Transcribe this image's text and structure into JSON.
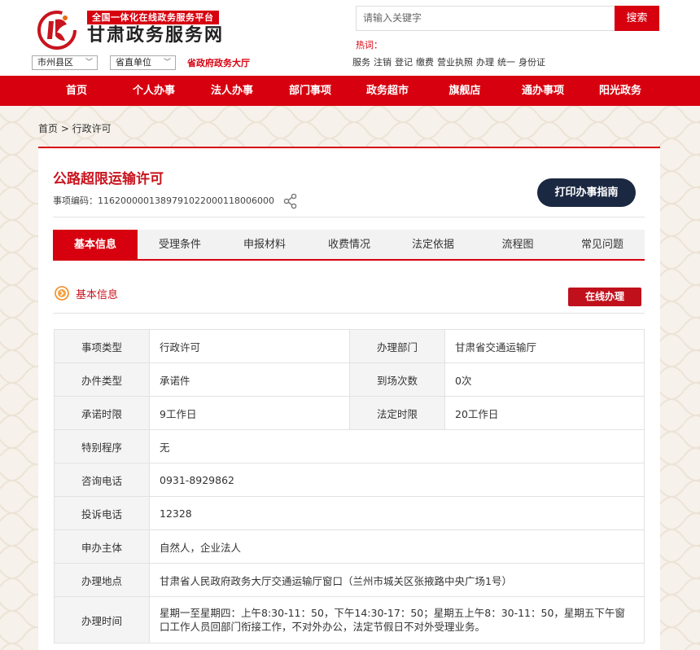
{
  "header": {
    "badge": "全国一体化在线政务服务平台",
    "site_title": "甘肃政务服务网",
    "region_select": "市州县区",
    "dept_select": "省直单位",
    "hall_link": "省政府政务大厅",
    "search_placeholder": "请输入关键字",
    "search_button": "搜索",
    "hot_label": "热词：",
    "hot_words": [
      "服务",
      "注销",
      "登记",
      "缴费",
      "营业执照",
      "办理",
      "统一",
      "身份证"
    ]
  },
  "nav": [
    "首页",
    "个人办事",
    "法人办事",
    "部门事项",
    "政务超市",
    "旗舰店",
    "通办事项",
    "阳光政务"
  ],
  "breadcrumb": "首页 >  行政许可",
  "item": {
    "title": "公路超限运输许可",
    "code_label": "事项编码：",
    "code": "11620000013897910220001180 06000",
    "print_button": "打印办事指南"
  },
  "tabs": [
    "基本信息",
    "受理条件",
    "申报材料",
    "收费情况",
    "法定依据",
    "流程图",
    "常见问题"
  ],
  "section": {
    "title": "基本信息",
    "online_button": "在线办理"
  },
  "table": {
    "r1": {
      "k1": "事项类型",
      "v1": "行政许可",
      "k2": "办理部门",
      "v2": "甘肃省交通运输厅"
    },
    "r2": {
      "k1": "办件类型",
      "v1": "承诺件",
      "k2": "到场次数",
      "v2": "0次"
    },
    "r3": {
      "k1": "承诺时限",
      "v1": "9工作日",
      "k2": "法定时限",
      "v2": "20工作日"
    },
    "r4": {
      "k": "特别程序",
      "v": "无"
    },
    "r5": {
      "k": "咨询电话",
      "v": "0931-8929862"
    },
    "r6": {
      "k": "投诉电话",
      "v": "12328"
    },
    "r7": {
      "k": "申办主体",
      "v": "自然人，企业法人"
    },
    "r8": {
      "k": "办理地点",
      "v": "甘肃省人民政府政务大厅交通运输厅窗口（兰州市城关区张掖路中央广场1号）"
    },
    "r9": {
      "k": "办理时间",
      "v": "星期一至星期四：上午8:30-11：50，下午14:30-17：50；星期五上午8：30-11：50，星期五下午窗口工作人员回部门衔接工作，不对外办公，法定节假日不对外受理业务。"
    }
  },
  "colors": {
    "brand_red": "#d7000f",
    "print_button_bg": "#1b2842"
  }
}
